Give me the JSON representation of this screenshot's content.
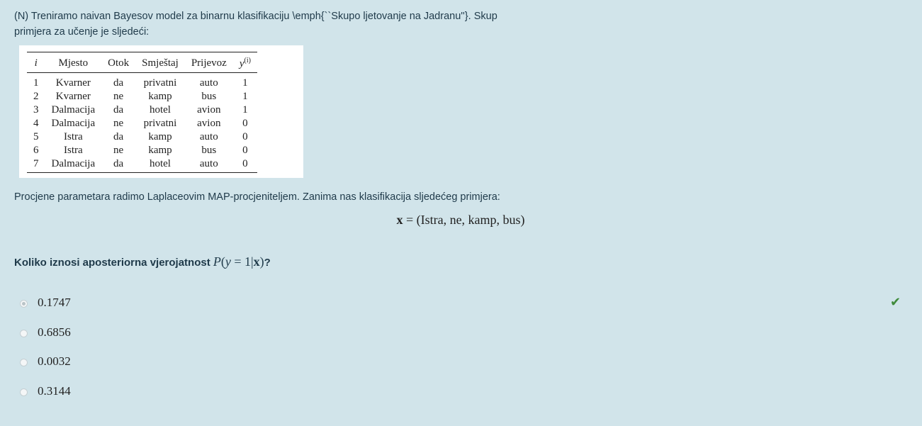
{
  "question_intro": "(N) Treniramo naivan Bayesov model za binarnu klasifikaciju \\emph{``Skupo ljetovanje na Jadranu''}. Skup primjera za učenje je sljedeći:",
  "table": {
    "headers": [
      "i",
      "Mjesto",
      "Otok",
      "Smještaj",
      "Prijevoz",
      "y",
      "(i)"
    ],
    "rows": [
      [
        "1",
        "Kvarner",
        "da",
        "privatni",
        "auto",
        "1"
      ],
      [
        "2",
        "Kvarner",
        "ne",
        "kamp",
        "bus",
        "1"
      ],
      [
        "3",
        "Dalmacija",
        "da",
        "hotel",
        "avion",
        "1"
      ],
      [
        "4",
        "Dalmacija",
        "ne",
        "privatni",
        "avion",
        "0"
      ],
      [
        "5",
        "Istra",
        "da",
        "kamp",
        "auto",
        "0"
      ],
      [
        "6",
        "Istra",
        "ne",
        "kamp",
        "bus",
        "0"
      ],
      [
        "7",
        "Dalmacija",
        "da",
        "hotel",
        "auto",
        "0"
      ]
    ]
  },
  "procedure_text": "Procjene parametara radimo Laplaceovim MAP-procjeniteljem. Zanima nas klasifikacija sljedećeg primjera:",
  "formula": {
    "var": "x",
    "rhs": "= (Istra, ne, kamp, bus)"
  },
  "question": {
    "prefix": "Koliko iznosi aposteriorna vjerojatnost",
    "math_p": "P",
    "math_open": "(",
    "math_y": "y",
    "math_mid": " = 1|",
    "math_x": "x",
    "math_close": ")",
    "suffix": "?"
  },
  "options": [
    {
      "label": "0.1747",
      "selected": true,
      "correct": true
    },
    {
      "label": "0.6856",
      "selected": false,
      "correct": false
    },
    {
      "label": "0.0032",
      "selected": false,
      "correct": false
    },
    {
      "label": "0.3144",
      "selected": false,
      "correct": false
    }
  ],
  "icons": {
    "correct": "check-icon"
  },
  "colors": {
    "background": "#d1e4ea",
    "text": "#1f3a4a",
    "correct": "#3f8a3a"
  }
}
